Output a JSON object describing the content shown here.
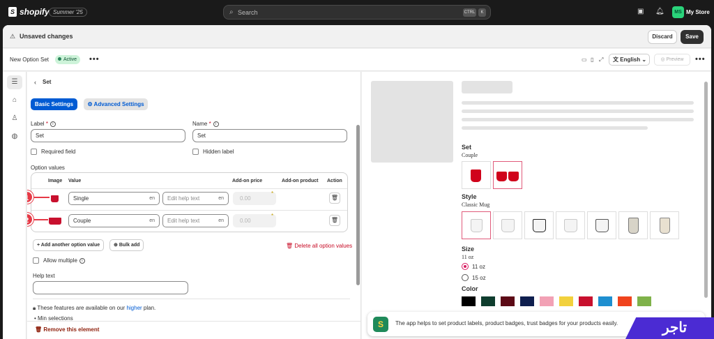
{
  "topbar": {
    "logo_text": "shopify",
    "edition_badge": "Summer '25",
    "search_placeholder": "Search",
    "kbd_ctrl": "CTRL",
    "kbd_k": "K",
    "avatar_initials": "MS",
    "store_name": "My Store"
  },
  "savebar": {
    "message": "Unsaved changes",
    "discard_label": "Discard",
    "save_label": "Save"
  },
  "header": {
    "title": "New Option Set",
    "status": "Active",
    "more": "•••",
    "language": "English",
    "preview_label": "Preview"
  },
  "panel": {
    "title": "Set",
    "tabs": [
      "Basic Settings",
      "Advanced Settings"
    ],
    "label_field": {
      "label": "Label",
      "value": "Set"
    },
    "name_field": {
      "label": "Name",
      "value": "Set"
    },
    "required_label": "Required field",
    "hidden_label": "Hidden label",
    "option_values_title": "Option values",
    "columns": [
      "Image",
      "Value",
      "Add-on price",
      "Add-on product",
      "Action"
    ],
    "rows": [
      {
        "value": "Single",
        "lang": "en",
        "help_placeholder": "Edit help text",
        "help_lang": "en",
        "price": "0.00",
        "marker": "1"
      },
      {
        "value": "Couple",
        "lang": "en",
        "help_placeholder": "Edit help text",
        "help_lang": "en",
        "price": "0.00",
        "marker": "2"
      }
    ],
    "add_option_label": "Add another option value",
    "bulk_add_label": "Bulk add",
    "delete_all_label": "Delete all option values",
    "allow_multiple_label": "Allow multiple",
    "help_text_label": "Help text",
    "feature_note_prefix": "These features are available on our",
    "feature_note_link": "higher",
    "feature_note_suffix": "plan.",
    "feature_bullet": "Min selections",
    "remove_label": "Remove this element"
  },
  "preview": {
    "set_title": "Set",
    "set_selected": "Couple",
    "style_title": "Style",
    "style_selected": "Classic Mug",
    "size_title": "Size",
    "size_selected": "11 oz",
    "size_options": [
      "11 oz",
      "15 oz"
    ],
    "color_title": "Color",
    "colors": [
      "#000000",
      "#0f3d2e",
      "#5c0a16",
      "#0f1f4f",
      "#f2a1b5",
      "#f2d13d",
      "#c8102e",
      "#1e8fd0",
      "#f0431d",
      "#7fb24a"
    ],
    "banner_text": "The app helps to set product labels, product badges, trust badges for your products easily.",
    "banner_logo": "S"
  },
  "watermark": "تاجر"
}
